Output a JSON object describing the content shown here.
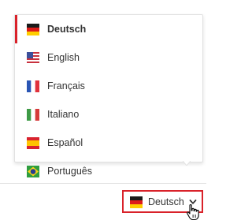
{
  "languages": {
    "items": [
      {
        "label": "Deutsch",
        "flag": "germany-flag-icon",
        "active": true
      },
      {
        "label": "English",
        "flag": "usa-flag-icon",
        "active": false
      },
      {
        "label": "Français",
        "flag": "france-flag-icon",
        "active": false
      },
      {
        "label": "Italiano",
        "flag": "italy-flag-icon",
        "active": false
      },
      {
        "label": "Español",
        "flag": "spain-flag-icon",
        "active": false
      },
      {
        "label": "Português",
        "flag": "brazil-flag-icon",
        "active": false
      }
    ]
  },
  "trigger": {
    "label": "Deutsch",
    "flag": "germany-flag-icon",
    "chevron": "chevron-down-icon"
  },
  "colors": {
    "accent": "#d9222a",
    "text": "#333333",
    "border": "#e2e2e2"
  }
}
